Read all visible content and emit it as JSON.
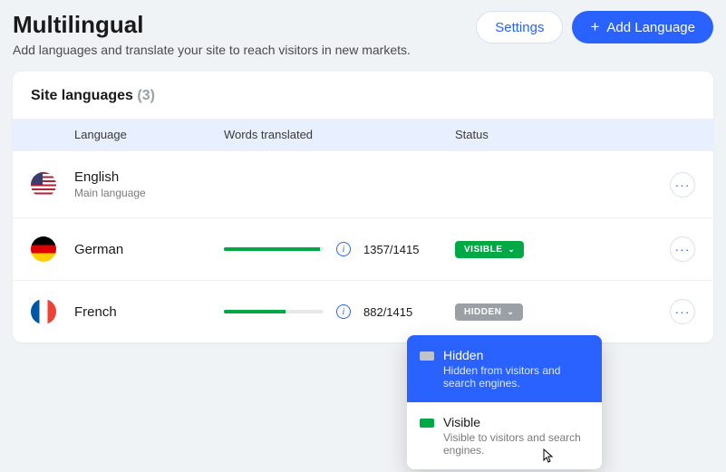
{
  "header": {
    "title": "Multilingual",
    "subtitle": "Add languages and translate your site to reach visitors in new markets.",
    "settings_label": "Settings",
    "add_language_label": "Add Language"
  },
  "card": {
    "title": "Site languages",
    "count": "(3)"
  },
  "columns": {
    "language": "Language",
    "words_translated": "Words translated",
    "status": "Status"
  },
  "languages": [
    {
      "name": "English",
      "subtitle": "Main language",
      "flag": "us",
      "words": "",
      "progress_pct": null,
      "status": null
    },
    {
      "name": "German",
      "subtitle": "",
      "flag": "de",
      "words": "1357/1415",
      "progress_pct": 96,
      "status": "VISIBLE",
      "status_class": "visible"
    },
    {
      "name": "French",
      "subtitle": "",
      "flag": "fr",
      "words": "882/1415",
      "progress_pct": 62,
      "status": "HIDDEN",
      "status_class": "hidden"
    }
  ],
  "dropdown": {
    "hidden": {
      "title": "Hidden",
      "desc": "Hidden from visitors and search engines."
    },
    "visible": {
      "title": "Visible",
      "desc": "Visible to visitors and search engines."
    }
  }
}
